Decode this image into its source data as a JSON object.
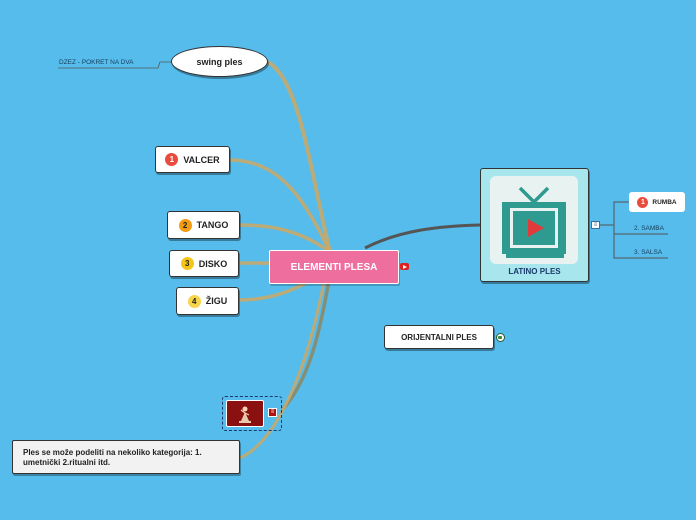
{
  "central": {
    "label": "ELEMENTI PLESA",
    "icon": "youtube-icon"
  },
  "swing": {
    "label": "swing ples",
    "sublabel": "DZEZ - POKRET NA DVA"
  },
  "left_items": [
    {
      "num": "1",
      "label": "VALCER"
    },
    {
      "num": "2",
      "label": "TANGO"
    },
    {
      "num": "3",
      "label": "DISKO"
    },
    {
      "num": "4",
      "label": "ŽIGU"
    }
  ],
  "latino": {
    "label": "LATINO PLES",
    "icon": "tv-play-icon",
    "children": [
      {
        "num": "1",
        "label": "RUMBA"
      },
      {
        "label": "2. SAMBA"
      },
      {
        "label": "3. SALSA"
      }
    ]
  },
  "orijentalni": {
    "label": "ORIJENTALNI PLES",
    "icon": "globe-icon"
  },
  "image_node": {
    "icon": "dancer-image-icon",
    "note_icon": "note-icon"
  },
  "note": {
    "text": "Ples se može podeliti na nekoliko kategorija: 1. umetnički 2.ritualni itd."
  },
  "colors": {
    "background": "#55bcec",
    "central": "#ee6f9e",
    "latino_bg": "#a7e6ec",
    "tv": "#2f9a8f",
    "play": "#e03a3a",
    "branch": "#c7a96b"
  }
}
